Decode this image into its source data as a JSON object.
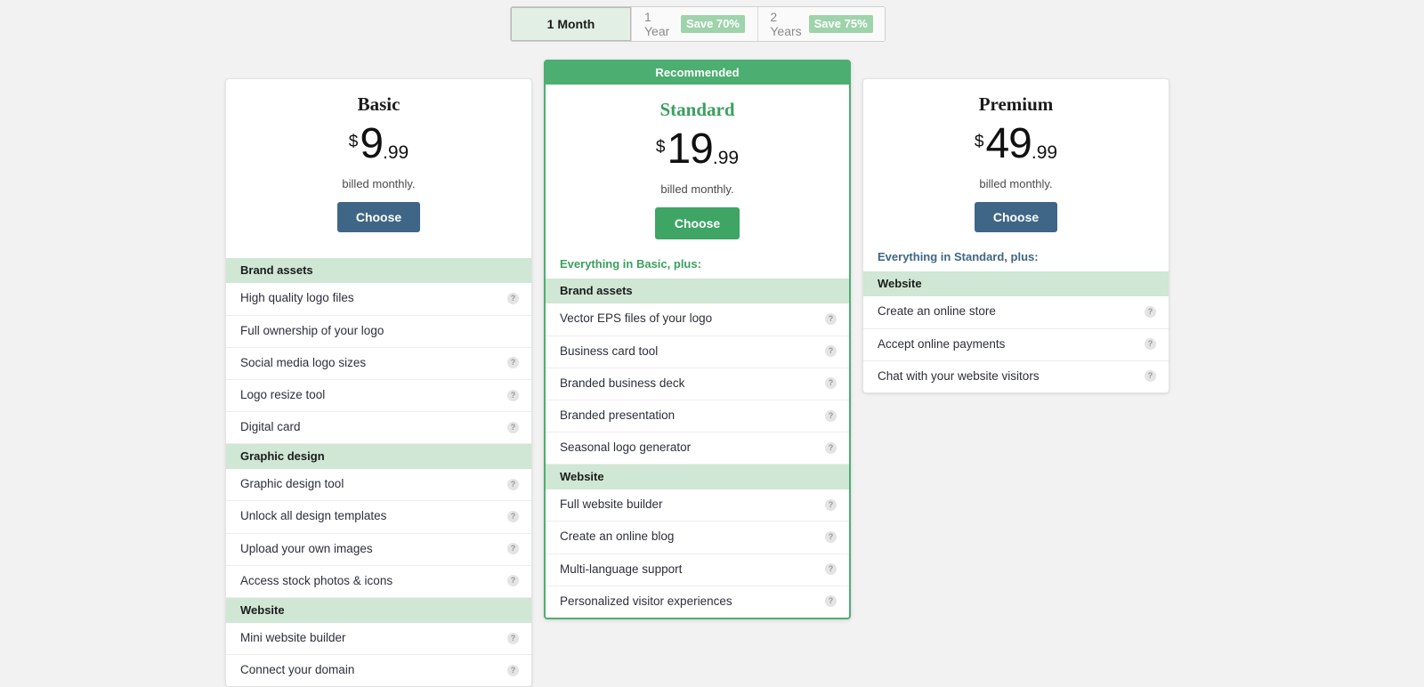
{
  "billing_toggle": {
    "name": "billing-period-toggle",
    "options": [
      {
        "label": "1 Month",
        "badge": "",
        "active": true
      },
      {
        "label": "1 Year",
        "badge": "Save 70%",
        "active": false
      },
      {
        "label": "2 Years",
        "badge": "Save 75%",
        "active": false
      }
    ]
  },
  "colors": {
    "page_background": "#f2f2f2",
    "accent_green": "#4caf71",
    "accent_blue": "#3f6686",
    "group_header_green": "#cfe7d4",
    "badge_green": "#9ed3ab",
    "active_tab_green": "#e2efe4"
  },
  "icons": {
    "help": "help-circle-icon",
    "help_glyph": "?"
  },
  "plans": [
    {
      "id": "basic",
      "name": "Basic",
      "ribbon": "",
      "currency": "$",
      "price_integer": "9",
      "price_decimal": ".99",
      "billed_note": "billed monthly.",
      "cta_label": "Choose",
      "cta_style": "blue",
      "everything_note": "",
      "groups": [
        {
          "title": "Brand assets",
          "features": [
            {
              "label": "High quality logo files",
              "has_help": true
            },
            {
              "label": "Full ownership of your logo",
              "has_help": false
            },
            {
              "label": "Social media logo sizes",
              "has_help": true
            },
            {
              "label": "Logo resize tool",
              "has_help": true
            },
            {
              "label": "Digital card",
              "has_help": true
            }
          ]
        },
        {
          "title": "Graphic design",
          "features": [
            {
              "label": "Graphic design tool",
              "has_help": true
            },
            {
              "label": "Unlock all design templates",
              "has_help": true
            },
            {
              "label": "Upload your own images",
              "has_help": true
            },
            {
              "label": "Access stock photos & icons",
              "has_help": true
            }
          ]
        },
        {
          "title": "Website",
          "features": [
            {
              "label": "Mini website builder",
              "has_help": true
            },
            {
              "label": "Connect your domain",
              "has_help": true
            }
          ]
        }
      ]
    },
    {
      "id": "standard",
      "name": "Standard",
      "ribbon": "Recommended",
      "currency": "$",
      "price_integer": "19",
      "price_decimal": ".99",
      "billed_note": "billed monthly.",
      "cta_label": "Choose",
      "cta_style": "green",
      "everything_note": "Everything in Basic, plus:",
      "groups": [
        {
          "title": "Brand assets",
          "features": [
            {
              "label": "Vector EPS files of your logo",
              "has_help": true
            },
            {
              "label": "Business card tool",
              "has_help": true
            },
            {
              "label": "Branded business deck",
              "has_help": true
            },
            {
              "label": "Branded presentation",
              "has_help": true
            },
            {
              "label": "Seasonal logo generator",
              "has_help": true
            }
          ]
        },
        {
          "title": "Website",
          "features": [
            {
              "label": "Full website builder",
              "has_help": true
            },
            {
              "label": "Create an online blog",
              "has_help": true
            },
            {
              "label": "Multi-language support",
              "has_help": true
            },
            {
              "label": "Personalized visitor experiences",
              "has_help": true
            }
          ]
        }
      ]
    },
    {
      "id": "premium",
      "name": "Premium",
      "ribbon": "",
      "currency": "$",
      "price_integer": "49",
      "price_decimal": ".99",
      "billed_note": "billed monthly.",
      "cta_label": "Choose",
      "cta_style": "blue",
      "everything_note": "Everything in Standard, plus:",
      "groups": [
        {
          "title": "Website",
          "features": [
            {
              "label": "Create an online store",
              "has_help": true
            },
            {
              "label": "Accept online payments",
              "has_help": true
            },
            {
              "label": "Chat with your website visitors",
              "has_help": true
            }
          ]
        }
      ]
    }
  ]
}
